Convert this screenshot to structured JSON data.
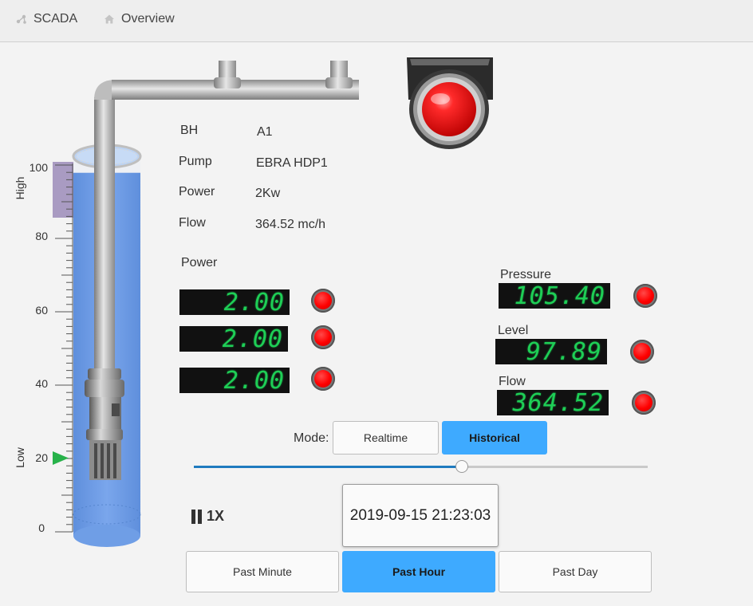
{
  "breadcrumb": {
    "app_label": "SCADA",
    "app_icon": "network-icon",
    "overview_label": "Overview",
    "overview_icon": "home-icon"
  },
  "info": [
    {
      "label": "BH",
      "value": "A1"
    },
    {
      "label": "Pump",
      "value": "EBRA HDP1"
    },
    {
      "label": "Power",
      "value": "2Kw"
    },
    {
      "label": "Flow",
      "value": "364.52 mc/h"
    }
  ],
  "power_section": {
    "title": "Power",
    "readings": [
      "2.00",
      "2.00",
      "2.00"
    ]
  },
  "gauges": {
    "pressure": {
      "label": "Pressure",
      "value": "105.40"
    },
    "level": {
      "label": "Level",
      "value": "97.89"
    },
    "flow": {
      "label": "Flow",
      "value": "364.52"
    }
  },
  "tank": {
    "scale_ticks": [
      "100",
      "80",
      "60",
      "40",
      "20",
      "0"
    ],
    "high_label": "High",
    "low_label": "Low",
    "water_level_percent": 97.89,
    "low_marker_value": 20,
    "high_band_range": [
      86,
      100
    ]
  },
  "mode": {
    "label": "Mode:",
    "options": [
      "Realtime",
      "Historical"
    ],
    "selected": "Historical"
  },
  "playback": {
    "speed_label": "1X",
    "slider_fraction": 0.59,
    "timestamp": "2019-09-15 21:23:03"
  },
  "range_buttons": {
    "options": [
      "Past Minute",
      "Past Hour",
      "Past Day"
    ],
    "selected": "Past Hour"
  },
  "colors": {
    "accent": "#3eaaff",
    "lcd_text": "#1ecf56",
    "alarm": "#ff0000",
    "water": "#6f9ee6",
    "slider_track": "#1f7bbf"
  }
}
